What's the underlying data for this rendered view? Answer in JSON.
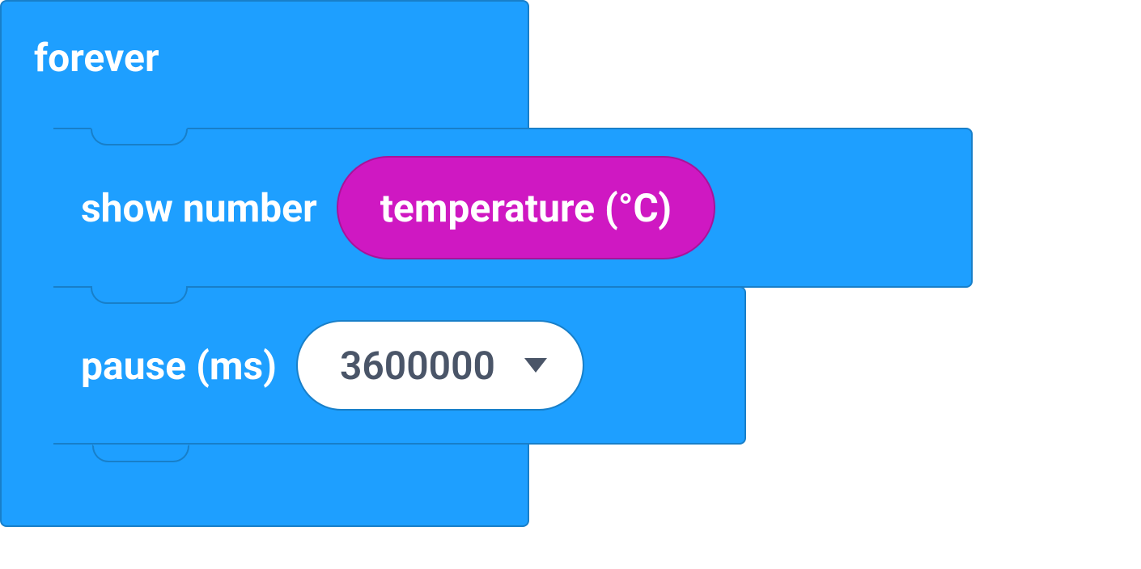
{
  "forever": {
    "label": "forever"
  },
  "show_number": {
    "label": "show number",
    "input_label": "temperature (°C)"
  },
  "pause": {
    "label": "pause (ms)",
    "value": "3600000"
  }
}
